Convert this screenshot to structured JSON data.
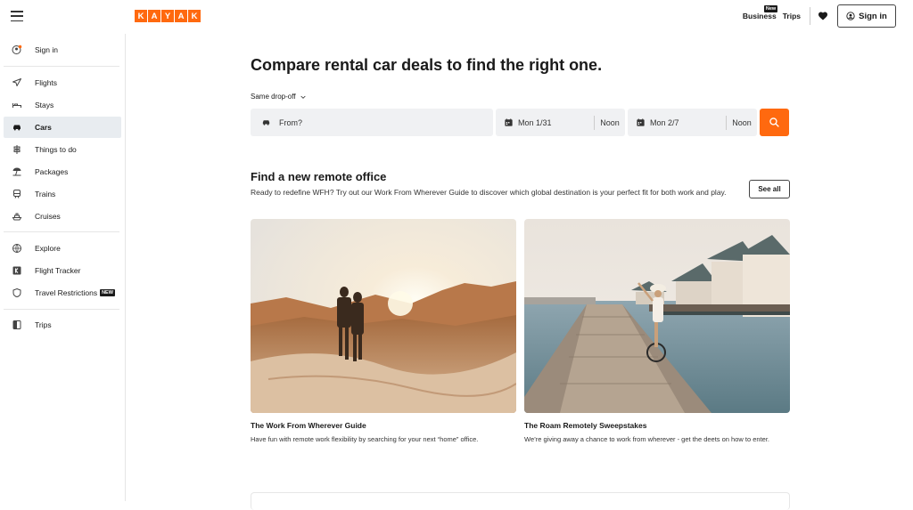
{
  "brand": {
    "letters": [
      "K",
      "A",
      "Y",
      "A",
      "K"
    ]
  },
  "header": {
    "business_label": "Business",
    "business_badge": "New",
    "trips_label": "Trips",
    "signin_label": "Sign in"
  },
  "sidebar": {
    "signin": "Sign in",
    "items": [
      {
        "label": "Flights",
        "icon": "plane-icon"
      },
      {
        "label": "Stays",
        "icon": "bed-icon"
      },
      {
        "label": "Cars",
        "icon": "car-icon",
        "active": true
      },
      {
        "label": "Things to do",
        "icon": "signpost-icon"
      },
      {
        "label": "Packages",
        "icon": "beach-umbrella-icon"
      },
      {
        "label": "Trains",
        "icon": "train-icon"
      },
      {
        "label": "Cruises",
        "icon": "ship-icon"
      }
    ],
    "items2": [
      {
        "label": "Explore",
        "icon": "globe-icon"
      },
      {
        "label": "Flight Tracker",
        "icon": "kayak-k-icon"
      },
      {
        "label": "Travel Restrictions",
        "icon": "shield-icon",
        "badge": "NEW"
      }
    ],
    "items3": [
      {
        "label": "Trips",
        "icon": "trips-icon"
      }
    ]
  },
  "search": {
    "title": "Compare rental car deals to find the right one.",
    "dropoff_label": "Same drop-off",
    "from_placeholder": "From?",
    "pickup_date": "Mon 1/31",
    "pickup_time": "Noon",
    "return_date": "Mon 2/7",
    "return_time": "Noon"
  },
  "remote": {
    "title": "Find a new remote office",
    "description": "Ready to redefine WFH? Try out our Work From Wherever Guide to discover which global destination is your perfect fit for both work and play.",
    "see_all": "See all",
    "cards": [
      {
        "title": "The Work From Wherever Guide",
        "desc": "Have fun with remote work flexibility by searching for your next “home” office."
      },
      {
        "title": "The Roam Remotely Sweepstakes",
        "desc": "We’re giving away a chance to work from wherever - get the deets on how to enter."
      }
    ]
  },
  "colors": {
    "brand": "#ff690f",
    "active_bg": "#e8ecf0",
    "field_bg": "#f0f1f3"
  }
}
